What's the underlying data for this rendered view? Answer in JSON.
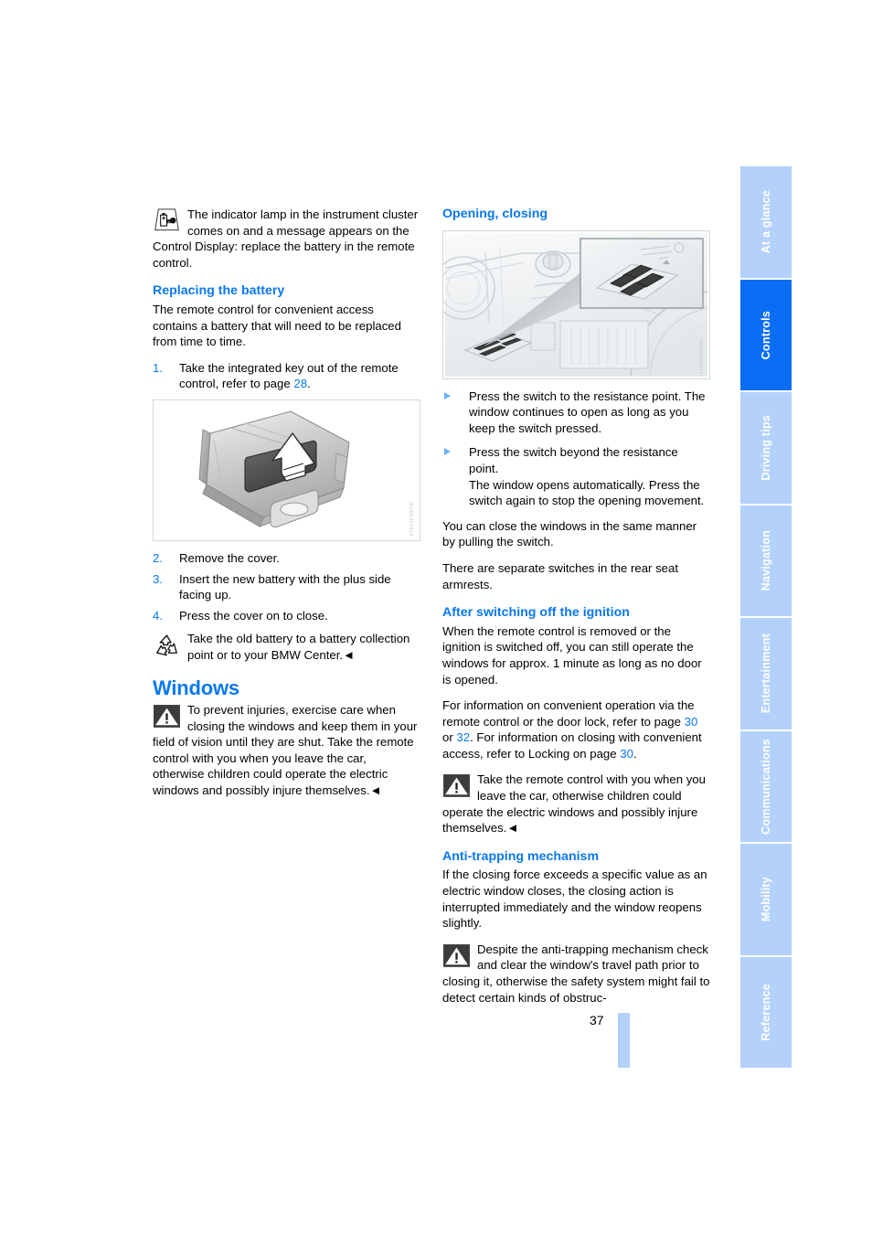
{
  "page": {
    "number": "37",
    "chapter": "Controls"
  },
  "tabs": [
    {
      "label": "At a glance",
      "active": false
    },
    {
      "label": "Controls",
      "active": true
    },
    {
      "label": "Driving tips",
      "active": false
    },
    {
      "label": "Navigation",
      "active": false
    },
    {
      "label": "Entertainment",
      "active": false
    },
    {
      "label": "Communications",
      "active": false
    },
    {
      "label": "Mobility",
      "active": false
    },
    {
      "label": "Reference",
      "active": false
    }
  ],
  "colors": {
    "accent_blue": "#0a78f0",
    "tab_active": "#0a6ef5",
    "tab_inactive": "#b3d1fb",
    "bullet_blue": "#6cb0f5"
  },
  "left_column": {
    "indicator_note": {
      "icon": "battery-key-indicator-icon",
      "text_indented": "The indicator lamp in the instrument cluster comes on and a message appears on the Control Display:",
      "text_full": "replace the battery in the remote control."
    },
    "replacing_battery": {
      "heading": "Replacing the battery",
      "intro": "The remote control for convenient access contains a battery that will need to be replaced from time to time.",
      "steps": [
        {
          "num": "1.",
          "text_before": "Take the integrated key out of the remote control, refer to page ",
          "pageref": "28",
          "text_after": "."
        },
        {
          "num": "2.",
          "text_before": "Remove the cover.",
          "pageref": "",
          "text_after": ""
        },
        {
          "num": "3.",
          "text_before": "Insert the new battery with the plus side facing up.",
          "pageref": "",
          "text_after": ""
        },
        {
          "num": "4.",
          "text_before": "Press the cover on to close.",
          "pageref": "",
          "text_after": ""
        }
      ],
      "figure_code": "WCM16F0413",
      "figure_alt": "Remote control with battery cover being slid off, arrow pointing up"
    },
    "recycle_note": {
      "icon": "recycling-icon",
      "text": "Take the old battery to a battery collection point or to your BMW Center.",
      "endmark": "◄"
    },
    "windows": {
      "heading": "Windows",
      "warning": {
        "icon": "warning-triangle-icon",
        "text": "To prevent injuries, exercise care when closing the windows and keep them in your field of vision until they are shut. Take the remote control with you when you leave the car, otherwise children could operate the electric windows and possibly injure themselves.",
        "endmark": "◄"
      }
    }
  },
  "right_column": {
    "opening_closing": {
      "heading": "Opening, closing",
      "figure_code": "WCM16F0414",
      "figure_alt": "Driver door window switches with inset close-up view",
      "bullets": [
        "Press the switch to the resistance point. The window continues to open as long as you keep the switch pressed.",
        "Press the switch beyond the resistance point.\nThe window opens automatically. Press the switch again to stop the opening movement."
      ],
      "paragraphs": [
        "You can close the windows in the same manner by pulling the switch.",
        "There are separate switches in the rear seat armrests."
      ]
    },
    "after_ignition": {
      "heading": "After switching off the ignition",
      "para1": "When the remote control is removed or the ignition is switched off, you can still operate the windows for approx. 1 minute as long as no door is opened.",
      "para2_a": "For information on convenient operation via the remote control or the door lock, refer to page ",
      "para2_ref1": "30",
      "para2_b": " or ",
      "para2_ref2": "32",
      "para2_c": ". For information on closing with convenient access, refer to Locking on page ",
      "para2_ref3": "30",
      "para2_d": ".",
      "warning": {
        "icon": "warning-triangle-icon",
        "text": "Take the remote control with you when you leave the car, otherwise children could operate the electric windows and possibly injure themselves.",
        "endmark": "◄"
      }
    },
    "anti_trapping": {
      "heading": "Anti-trapping mechanism",
      "para1": "If the closing force exceeds a specific value as an electric window closes, the closing action is interrupted immediately and the window reopens slightly.",
      "warning": {
        "icon": "warning-triangle-icon",
        "text": "Despite the anti-trapping mechanism check and clear the window's travel path prior to closing it, otherwise the safety system might fail to detect certain kinds of obstruc-"
      }
    }
  }
}
